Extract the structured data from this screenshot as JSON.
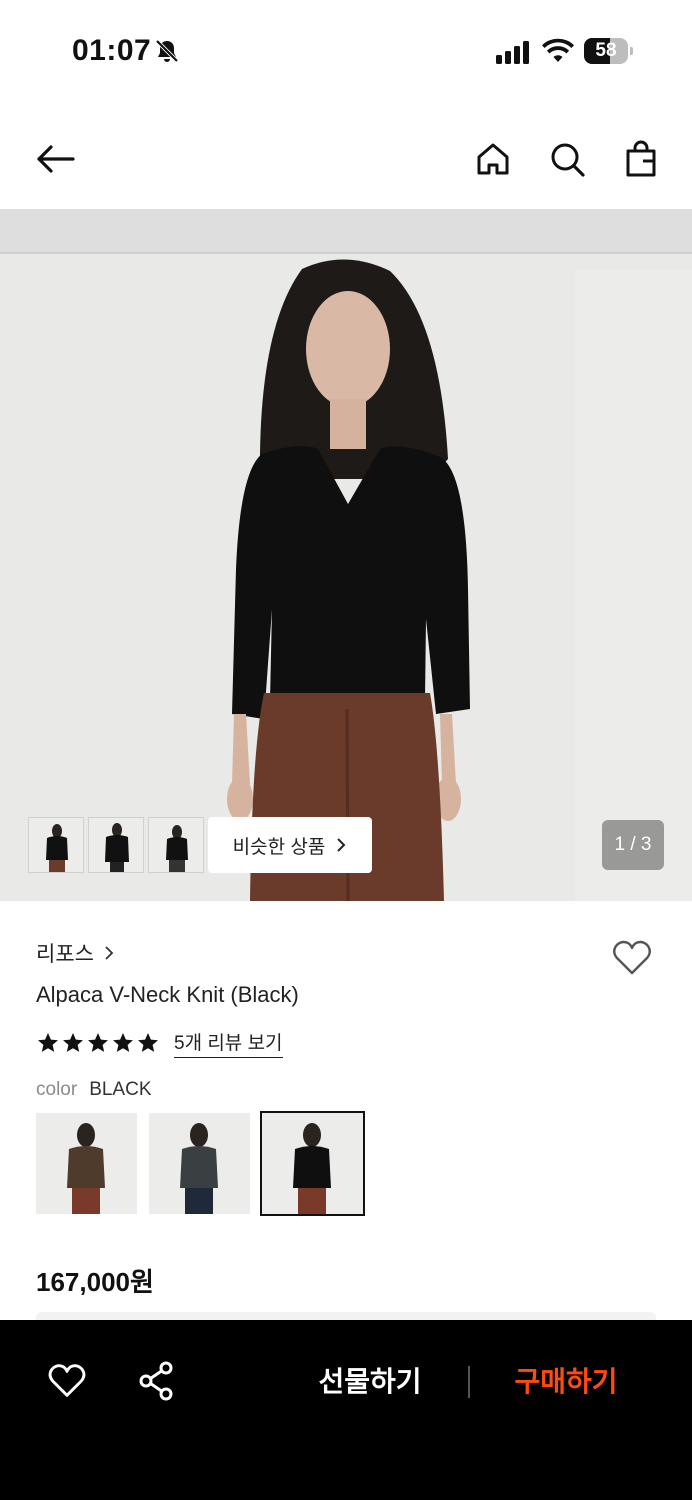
{
  "status_bar": {
    "time": "01:07",
    "battery_percent": 58,
    "battery_text": "58"
  },
  "nav": {
    "icons": [
      "back-arrow-icon",
      "home-icon",
      "search-icon",
      "shopping-bag-icon"
    ]
  },
  "gallery": {
    "similar_button_label": "비슷한 상품",
    "page_indicator": "1 / 3",
    "thumbnail_count": 3
  },
  "product": {
    "brand": "리포스",
    "title": "Alpaca V-Neck Knit (Black)",
    "rating_stars": 5,
    "review_link": "5개 리뷰 보기",
    "color_label": "color",
    "color_value": "BLACK",
    "color_swatches": [
      "brown",
      "charcoal",
      "black"
    ],
    "selected_swatch": "black",
    "price": "167,000원"
  },
  "bottom_bar": {
    "gift_label": "선물하기",
    "buy_label": "구매하기",
    "colors": {
      "buy": "#ff4b12",
      "background": "#000000"
    }
  }
}
